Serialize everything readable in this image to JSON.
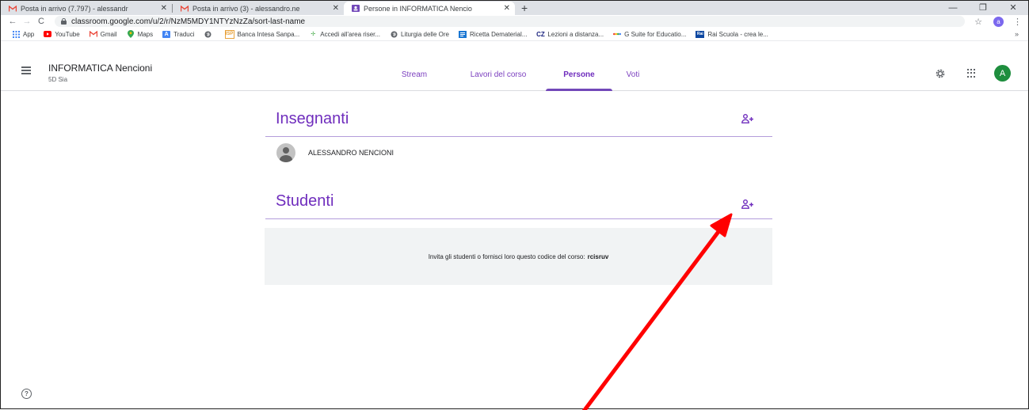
{
  "browser": {
    "tabs": [
      {
        "title": "Posta in arrivo (7.797) - alessandr",
        "favicon": "gmail-icon",
        "active": false
      },
      {
        "title": "Posta in arrivo (3) - alessandro.ne",
        "favicon": "gmail-icon",
        "active": false
      },
      {
        "title": "Persone in INFORMATICA Nencio",
        "favicon": "classroom-icon",
        "active": true
      }
    ],
    "tab_close_glyph": "✕",
    "new_tab_glyph": "+",
    "window_controls": [
      "—",
      "❐",
      "✕"
    ],
    "url": "classroom.google.com/u/2/r/NzM5MDY1NTYzNzZa/sort-last-name",
    "profile_initial": "a",
    "bookmarks": [
      {
        "label": "App",
        "icon": "apps-grid-icon",
        "color": "#4285f4"
      },
      {
        "label": "YouTube",
        "icon": "youtube-icon",
        "color": "#ff0000"
      },
      {
        "label": "Gmail",
        "icon": "gmail-icon",
        "color": "#ea4335"
      },
      {
        "label": "Maps",
        "icon": "maps-icon",
        "color": "#34a853"
      },
      {
        "label": "Traduci",
        "icon": "translate-icon",
        "color": "#4285f4"
      },
      {
        "label": "",
        "icon": "globe-icon",
        "color": "#5f6368"
      },
      {
        "label": "Banca Intesa Sanpa...",
        "icon": "bank-icon",
        "color": "#e8a33d"
      },
      {
        "label": "Accedi all'area riser...",
        "icon": "sparkle-icon",
        "color": "#4caf50"
      },
      {
        "label": "Liturgia delle Ore",
        "icon": "globe-icon",
        "color": "#5f6368"
      },
      {
        "label": "Ricetta Dematerial...",
        "icon": "doc-icon",
        "color": "#1976d2"
      },
      {
        "label": "Lezioni a distanza...",
        "icon": "cz-icon",
        "color": "#1a237e"
      },
      {
        "label": "G Suite for Educatio...",
        "icon": "gsuite-icon",
        "color": "#fbbc04"
      },
      {
        "label": "Rai Scuola - crea le...",
        "icon": "rai-icon",
        "color": "#0d47a1"
      }
    ],
    "bookmarks_more": "»"
  },
  "classroom": {
    "course_title": "INFORMATICA Nencioni",
    "course_section": "5D Sia",
    "tabs": [
      "Stream",
      "Lavori del corso",
      "Persone",
      "Voti"
    ],
    "active_tab": "Persone",
    "user_initial": "A",
    "accent_color": "#6f2dbd",
    "teachers_heading": "Insegnanti",
    "teachers": [
      "ALESSANDRO NENCIONI"
    ],
    "students_heading": "Studenti",
    "invite_text": "Invita gli studenti o fornisci loro questo codice del corso:",
    "class_code": "rcisruv",
    "help_glyph": "?"
  },
  "annotation": {
    "type": "arrow",
    "color": "#ff0000",
    "points_to": "add-student-icon"
  }
}
